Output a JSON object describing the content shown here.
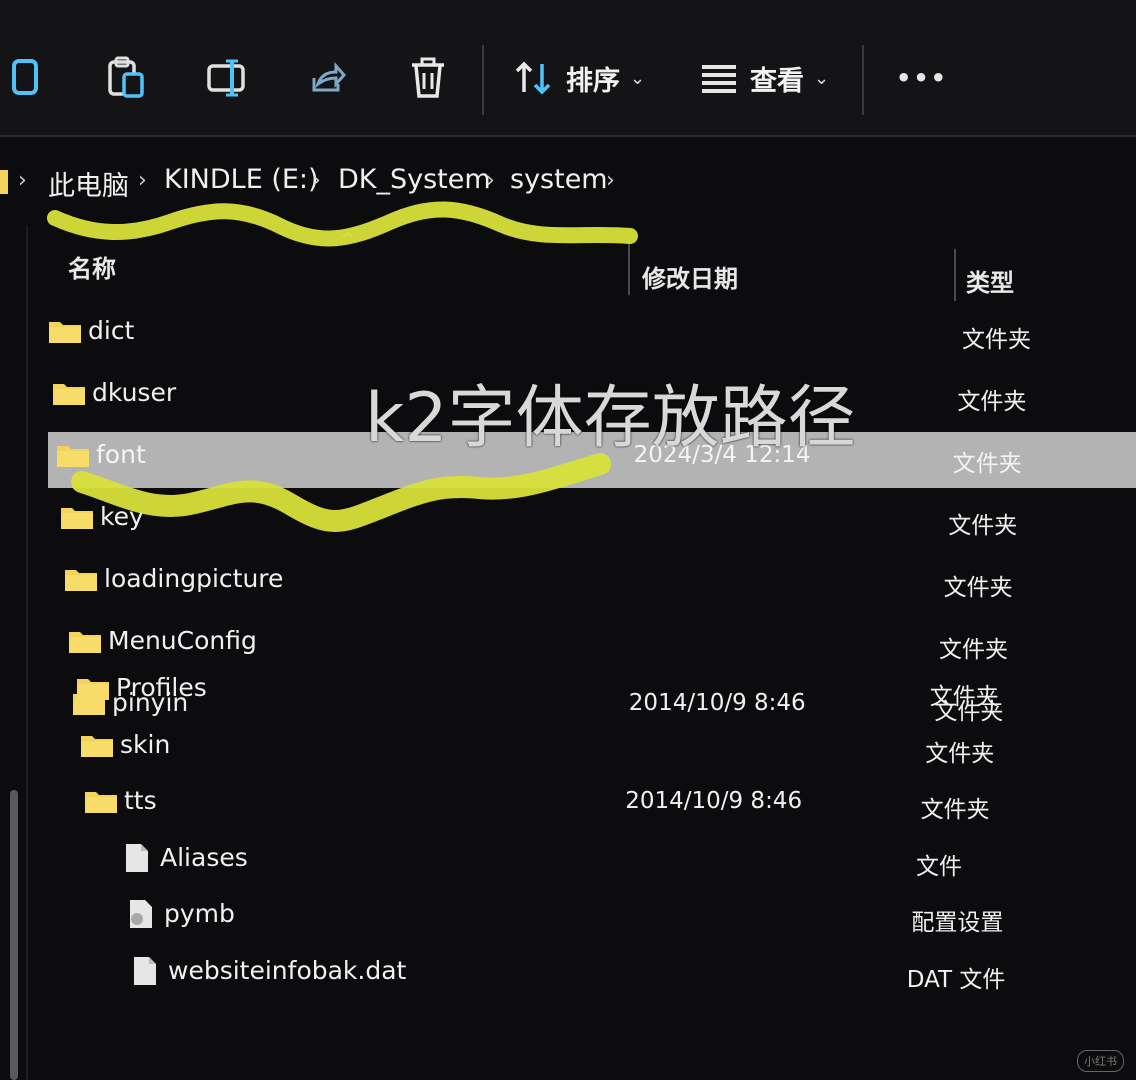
{
  "toolbar": {
    "sort_label": "排序",
    "view_label": "查看",
    "more_label": "•••"
  },
  "breadcrumb": [
    "此电脑",
    "KINDLE (E:)",
    "DK_System",
    "system"
  ],
  "columns": {
    "name": "名称",
    "modified": "修改日期",
    "type": "类型"
  },
  "files": [
    {
      "name": "dict",
      "date": "",
      "type": "文件夹",
      "kind": "folder"
    },
    {
      "name": "dkuser",
      "date": "",
      "type": "文件夹",
      "kind": "folder"
    },
    {
      "name": "font",
      "date": "2024/3/4 12:14",
      "type": "文件夹",
      "kind": "folder",
      "selected": true
    },
    {
      "name": "key",
      "date": "",
      "type": "文件夹",
      "kind": "folder"
    },
    {
      "name": "loadingpicture",
      "date": "",
      "type": "文件夹",
      "kind": "folder"
    },
    {
      "name": "MenuConfig",
      "date": "",
      "type": "文件夹",
      "kind": "folder"
    },
    {
      "name": "pinyin",
      "date": "2014/10/9 8:46",
      "type": "文件夹",
      "kind": "folder"
    },
    {
      "name": "Profiles",
      "date": "",
      "type": "文件夹",
      "kind": "folder"
    },
    {
      "name": "skin",
      "date": "",
      "type": "文件夹",
      "kind": "folder"
    },
    {
      "name": "tts",
      "date": "2014/10/9 8:46",
      "type": "文件夹",
      "kind": "folder"
    },
    {
      "name": "Aliases",
      "date": "",
      "type": "文件",
      "kind": "file"
    },
    {
      "name": "pymb",
      "date": "",
      "type": "配置设置",
      "kind": "config"
    },
    {
      "name": "websiteinfobak.dat",
      "date": "",
      "type": "DAT 文件",
      "kind": "file"
    }
  ],
  "overlay_caption": "k2字体存放路径",
  "watermark": "小红书",
  "colors": {
    "folder": "#f3d35a",
    "highlighter": "#d9e03a",
    "selection": "#bdbdbd"
  }
}
